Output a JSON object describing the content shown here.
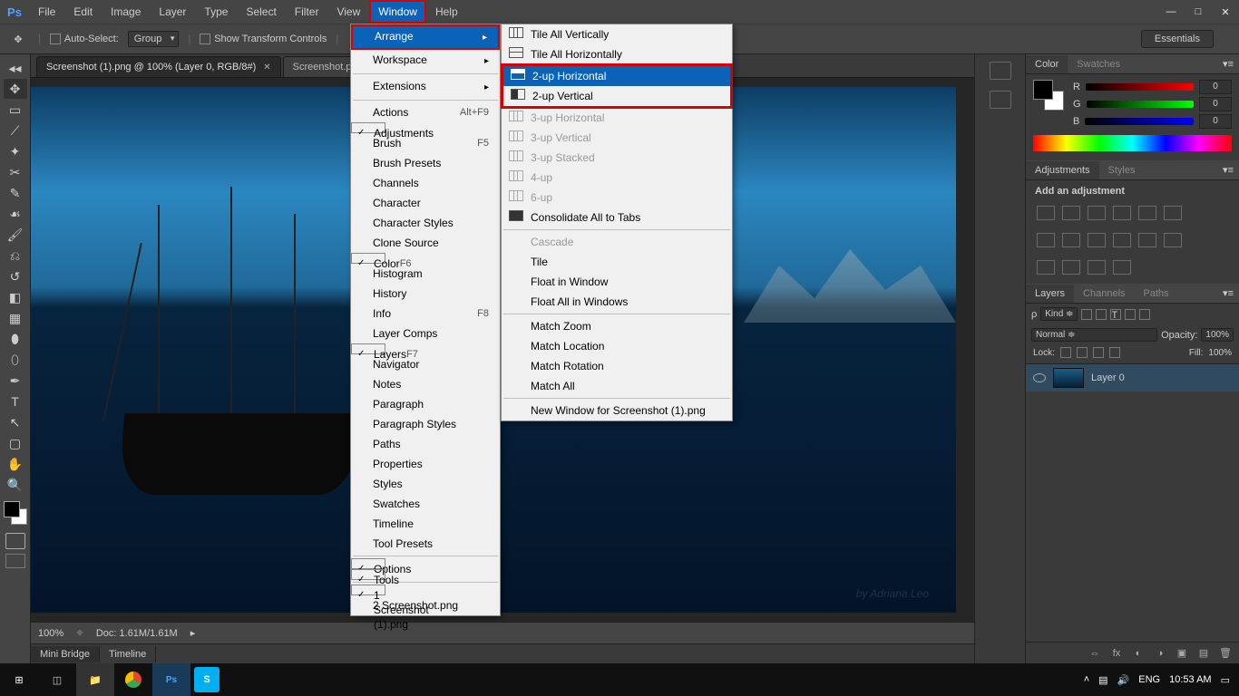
{
  "menubar": [
    "File",
    "Edit",
    "Image",
    "Layer",
    "Type",
    "Select",
    "Filter",
    "View",
    "Window",
    "Help"
  ],
  "active_menu": "Window",
  "workspace": "Essentials",
  "optionsbar": {
    "auto": "Auto-Select:",
    "group": "Group",
    "transform": "Show Transform Controls"
  },
  "tabs": [
    {
      "label": "Screenshot (1).png @ 100% (Layer 0, RGB/8#)",
      "active": true
    },
    {
      "label": "Screenshot.p",
      "active": false
    }
  ],
  "window_menu": [
    {
      "t": "Arrange",
      "sub": true,
      "hl": true,
      "red": true
    },
    {
      "t": "Workspace",
      "sub": true
    },
    {
      "sep": true
    },
    {
      "t": "Extensions",
      "sub": true
    },
    {
      "sep": true
    },
    {
      "t": "Actions",
      "sc": "Alt+F9"
    },
    {
      "t": "Adjustments",
      "chk": true
    },
    {
      "t": "Brush",
      "sc": "F5"
    },
    {
      "t": "Brush Presets"
    },
    {
      "t": "Channels"
    },
    {
      "t": "Character"
    },
    {
      "t": "Character Styles"
    },
    {
      "t": "Clone Source"
    },
    {
      "t": "Color",
      "chk": true,
      "sc": "F6"
    },
    {
      "t": "Histogram"
    },
    {
      "t": "History"
    },
    {
      "t": "Info",
      "sc": "F8"
    },
    {
      "t": "Layer Comps"
    },
    {
      "t": "Layers",
      "chk": true,
      "sc": "F7"
    },
    {
      "t": "Navigator"
    },
    {
      "t": "Notes"
    },
    {
      "t": "Paragraph"
    },
    {
      "t": "Paragraph Styles"
    },
    {
      "t": "Paths"
    },
    {
      "t": "Properties"
    },
    {
      "t": "Styles"
    },
    {
      "t": "Swatches"
    },
    {
      "t": "Timeline"
    },
    {
      "t": "Tool Presets"
    },
    {
      "sep": true
    },
    {
      "t": "Options",
      "chk": true
    },
    {
      "t": "Tools",
      "chk": true
    },
    {
      "sep": true
    },
    {
      "t": "1 Screenshot (1).png",
      "chk": true
    },
    {
      "t": "2 Screenshot.png"
    }
  ],
  "arrange_menu": {
    "group1": [
      {
        "t": "Tile All Vertically",
        "ic": "vvv"
      },
      {
        "t": "Tile All Horizontally",
        "ic": "hhh"
      }
    ],
    "redgroup": [
      {
        "t": "2-up Horizontal",
        "ic": "2h",
        "hl": true
      },
      {
        "t": "2-up Vertical",
        "ic": "2v"
      }
    ],
    "group2": [
      {
        "t": "3-up Horizontal",
        "ic": "3h",
        "dis": true
      },
      {
        "t": "3-up Vertical",
        "ic": "3v",
        "dis": true
      },
      {
        "t": "3-up Stacked",
        "ic": "3s",
        "dis": true
      },
      {
        "t": "4-up",
        "ic": "4",
        "dis": true
      },
      {
        "t": "6-up",
        "ic": "6",
        "dis": true
      },
      {
        "t": "Consolidate All to Tabs",
        "ic": "solid"
      }
    ],
    "group3": [
      {
        "t": "Cascade",
        "dis": true
      },
      {
        "t": "Tile"
      },
      {
        "t": "Float in Window"
      },
      {
        "t": "Float All in Windows"
      }
    ],
    "group4": [
      {
        "t": "Match Zoom"
      },
      {
        "t": "Match Location"
      },
      {
        "t": "Match Rotation"
      },
      {
        "t": "Match All"
      }
    ],
    "group5": [
      {
        "t": "New Window for Screenshot (1).png"
      }
    ]
  },
  "color": {
    "tabs": [
      "Color",
      "Swatches"
    ],
    "r": 0,
    "g": 0,
    "b": 0
  },
  "adjustments": {
    "tabs": [
      "Adjustments",
      "Styles"
    ],
    "label": "Add an adjustment"
  },
  "layers": {
    "tabs": [
      "Layers",
      "Channels",
      "Paths"
    ],
    "kind": "Kind",
    "blend": "Normal",
    "opacity_l": "Opacity:",
    "opacity": "100%",
    "lock": "Lock:",
    "fill_l": "Fill:",
    "fill": "100%",
    "layer": "Layer 0"
  },
  "status": {
    "zoom": "100%",
    "doc": "Doc: 1.61M/1.61M"
  },
  "minibridge": [
    "Mini Bridge",
    "Timeline"
  ],
  "taskbar": {
    "lang": "ENG",
    "time": "10:53 AM"
  },
  "watermark": "by Adriana Leo"
}
